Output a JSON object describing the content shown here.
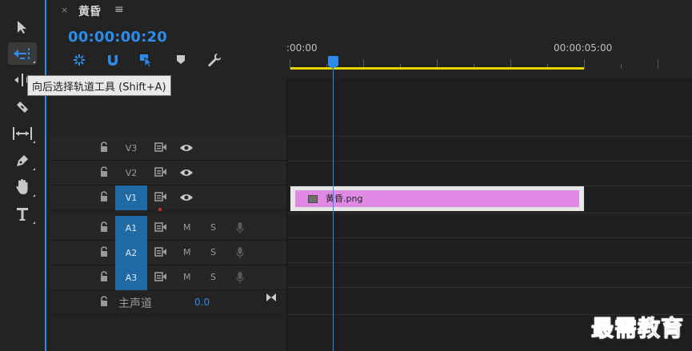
{
  "panel": {
    "close_glyph": "×",
    "title": "黄昏",
    "menu_glyph": "≡",
    "timecode": "00:00:00:20"
  },
  "tools": [
    {
      "name": "selection-tool",
      "icon": "arrow-pointer-icon",
      "active": false
    },
    {
      "name": "track-select-backward-tool",
      "icon": "track-select-backward-icon",
      "active": true
    },
    {
      "name": "ripple-edit-tool",
      "icon": "ripple-edit-icon",
      "active": false
    },
    {
      "name": "razor-tool",
      "icon": "razor-icon",
      "active": false
    },
    {
      "name": "slip-tool",
      "icon": "slip-icon",
      "active": false
    },
    {
      "name": "pen-tool",
      "icon": "pen-icon",
      "active": false
    },
    {
      "name": "hand-tool",
      "icon": "hand-icon",
      "active": false
    },
    {
      "name": "type-tool",
      "icon": "type-icon",
      "active": false
    }
  ],
  "tooltip": "向后选择轨道工具 (Shift+A)",
  "timeline_controls": [
    "snap-icon",
    "magnet-icon",
    "linked-selection-icon",
    "marker-icon",
    "wrench-icon"
  ],
  "ruler": {
    "start_label": ":00:00",
    "end_label": "00:00:05:00"
  },
  "tracks": [
    {
      "label": "V3",
      "kind": "video",
      "target": false
    },
    {
      "label": "V2",
      "kind": "video",
      "target": false
    },
    {
      "label": "V1",
      "kind": "video",
      "target": true
    },
    {
      "label": "A1",
      "kind": "audio",
      "target": true,
      "m": "M",
      "s": "S"
    },
    {
      "label": "A2",
      "kind": "audio",
      "target": true,
      "m": "M",
      "s": "S"
    },
    {
      "label": "A3",
      "kind": "audio",
      "target": true,
      "m": "M",
      "s": "S"
    }
  ],
  "master": {
    "label": "主声道",
    "value": "0.0"
  },
  "clip": {
    "name": "黄昏.png"
  },
  "watermark": "最需教育",
  "colors": {
    "accent": "#2d8ceb",
    "work_area": "#e6d400",
    "clip": "#e08ae6",
    "target": "#1f6aa5",
    "watermark": "#1a2fb8"
  }
}
